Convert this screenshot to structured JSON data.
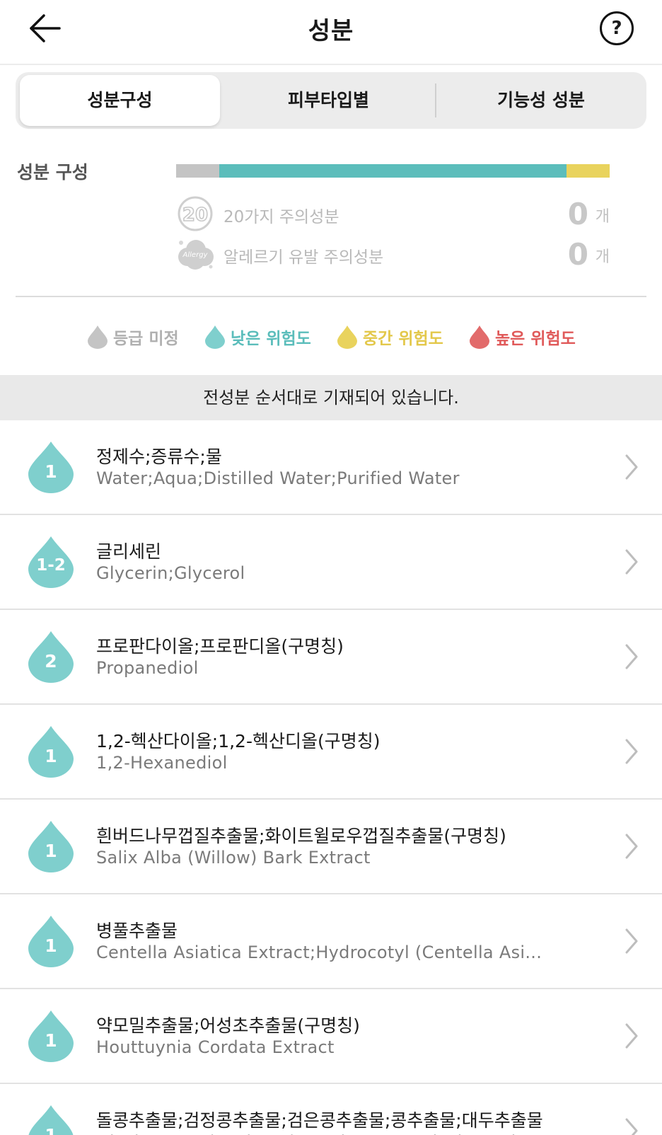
{
  "header": {
    "title": "성분",
    "help_label": "?"
  },
  "tabs": [
    {
      "label": "성분구성",
      "active": true
    },
    {
      "label": "피부타입별",
      "active": false
    },
    {
      "label": "기능성 성분",
      "active": false
    }
  ],
  "composition": {
    "label": "성분 구성",
    "bar_segments": [
      {
        "name": "등급 미정",
        "fraction": 0.1,
        "color": "#c4c4c4"
      },
      {
        "name": "낮은 위험도",
        "fraction": 0.8,
        "color": "#5bbdbb"
      },
      {
        "name": "중간 위험도",
        "fraction": 0.1,
        "color": "#e9d35d"
      }
    ],
    "warnings": [
      {
        "badge": "20",
        "label": "20가지 주의성분",
        "count": "0",
        "unit": "개"
      },
      {
        "badge": "Allergy",
        "label": "알레르기 유발 주의성분",
        "count": "0",
        "unit": "개"
      }
    ]
  },
  "legend": [
    {
      "label": "등급 미정",
      "color": "#c4c4c4"
    },
    {
      "label": "낮은 위험도",
      "color": "#7fcfcd"
    },
    {
      "label": "중간 위험도",
      "color": "#e9d35d"
    },
    {
      "label": "높은 위험도",
      "color": "#e26b6b"
    }
  ],
  "notice": "전성분 순서대로 기재되어 있습니다.",
  "ingredients": [
    {
      "grade": "1",
      "korean": "정제수;증류수;물",
      "english": "Water;Aqua;Distilled Water;Purified Water"
    },
    {
      "grade": "1-2",
      "korean": "글리세린",
      "english": "Glycerin;Glycerol"
    },
    {
      "grade": "2",
      "korean": "프로판다이올;프로판디올(구명칭)",
      "english": "Propanediol"
    },
    {
      "grade": "1",
      "korean": "1,2-헥산다이올;1,2-헥산디올(구명칭)",
      "english": "1,2-Hexanediol"
    },
    {
      "grade": "1",
      "korean": "흰버드나무껍질추출물;화이트윌로우껍질추출물(구명칭)",
      "english": "Salix Alba (Willow) Bark Extract"
    },
    {
      "grade": "1",
      "korean": "병풀추출물",
      "english": "Centella Asiatica Extract;Hydrocotyl (Centella Asi..."
    },
    {
      "grade": "1",
      "korean": "약모밀추출물;어성초추출물(구명칭)",
      "english": "Houttuynia Cordata Extract"
    },
    {
      "grade": "1",
      "korean": "돌콩추출물;검정콩추출물;검은콩추출물;콩추출물;대두추출물",
      "english": "Glycine Max (Soybean) Seed Extract;Glycine Soja..."
    }
  ],
  "colors": {
    "low_risk_drop": "#7fcfcd"
  },
  "icons": {
    "back": "arrow-left-icon",
    "help": "question-circle-icon",
    "row_chevron": "chevron-right-icon"
  }
}
